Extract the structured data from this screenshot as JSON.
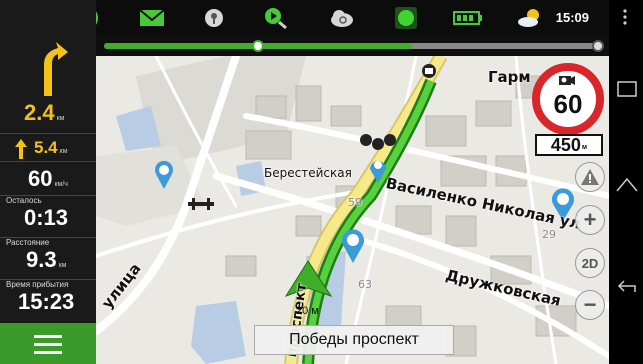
{
  "status_bar": {
    "time": "15:09",
    "icons": [
      "globe-icon",
      "volume-icon",
      "mail-icon",
      "location-pin-icon",
      "satellite-icon",
      "cloud-sync-icon",
      "gps-status-icon",
      "battery-icon",
      "weather-icon"
    ]
  },
  "route_progress": {
    "progress": 0.62
  },
  "left_panel": {
    "next_turn_distance": "2.4",
    "next_turn_unit": "км",
    "second_turn_distance": "5.4",
    "second_turn_unit": "км",
    "speed": "60",
    "speed_unit": "км/ч",
    "remaining_label": "Осталось",
    "remaining_value": "0:13",
    "distance_label": "Расстояние",
    "distance_value": "9.3",
    "distance_unit": "км",
    "arrival_label": "Время прибытия",
    "arrival_value": "15:23"
  },
  "map": {
    "labels": {
      "garm": "Гарм",
      "berestey": "Берестейская",
      "vasilenko": "Василенко Николая ул",
      "druzhkov": "Дружковская",
      "ulitsa": "улица",
      "prospekt": "проспект",
      "num59": "59",
      "num63": "63",
      "num29": "29"
    },
    "scale": "20 м"
  },
  "speed_limit": "60",
  "distance_to_camera": "450",
  "distance_to_camera_unit": "м",
  "controls": {
    "zoom_in": "+",
    "zoom_out": "−",
    "mode_2d": "2D"
  },
  "current_street": "Победы проспект",
  "colors": {
    "route": "#3fae29",
    "accent_yellow": "#f2c21a",
    "speed_sign_red": "#d8262b",
    "map_bg": "#e9e7e2"
  }
}
